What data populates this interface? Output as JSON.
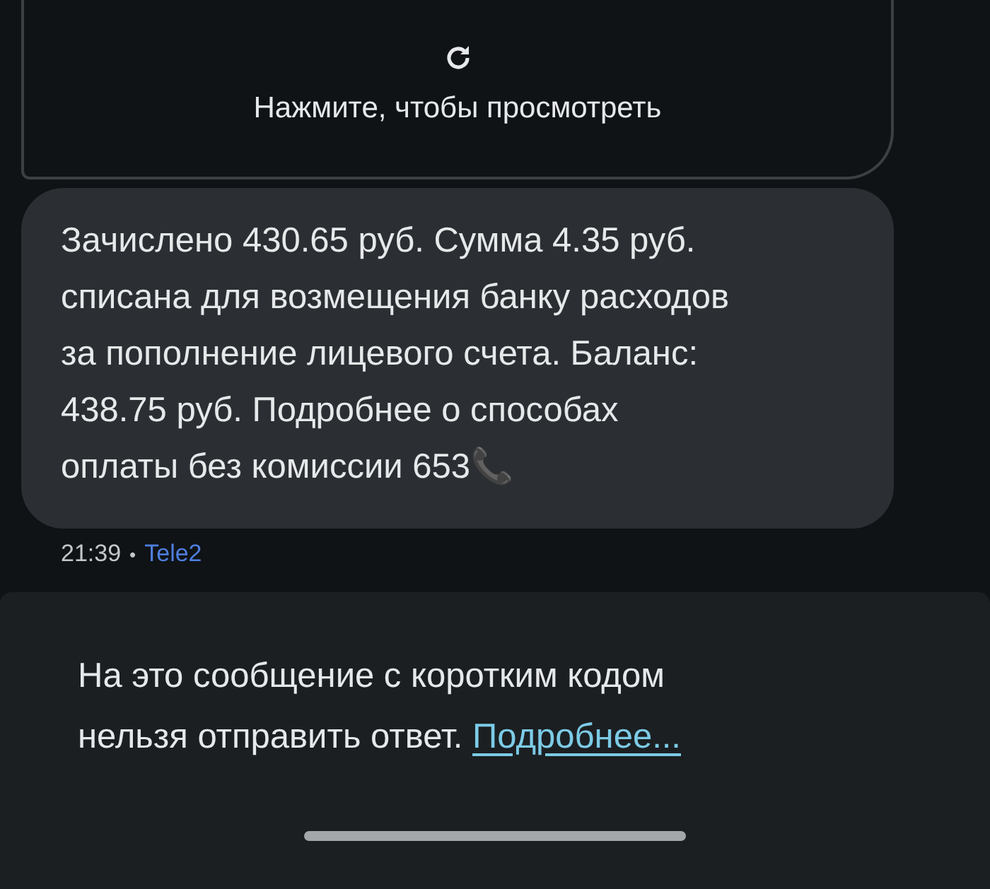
{
  "preview_card": {
    "label": "Нажмите, чтобы просмотреть"
  },
  "message": {
    "lines": [
      "Зачислено 430.65 руб. Сумма 4.35 руб.",
      "списана для возмещения банку расходов",
      "за пополнение лицевого счета. Баланс:",
      "438.75 руб. Подробнее о способах",
      "оплаты без комиссии 653📞"
    ],
    "time": "21:39",
    "separator": "•",
    "sender": "Tele2"
  },
  "reply_notice": {
    "text": "На это сообщение с коротким кодом нельзя отправить ответ.",
    "link": "Подробнее..."
  }
}
